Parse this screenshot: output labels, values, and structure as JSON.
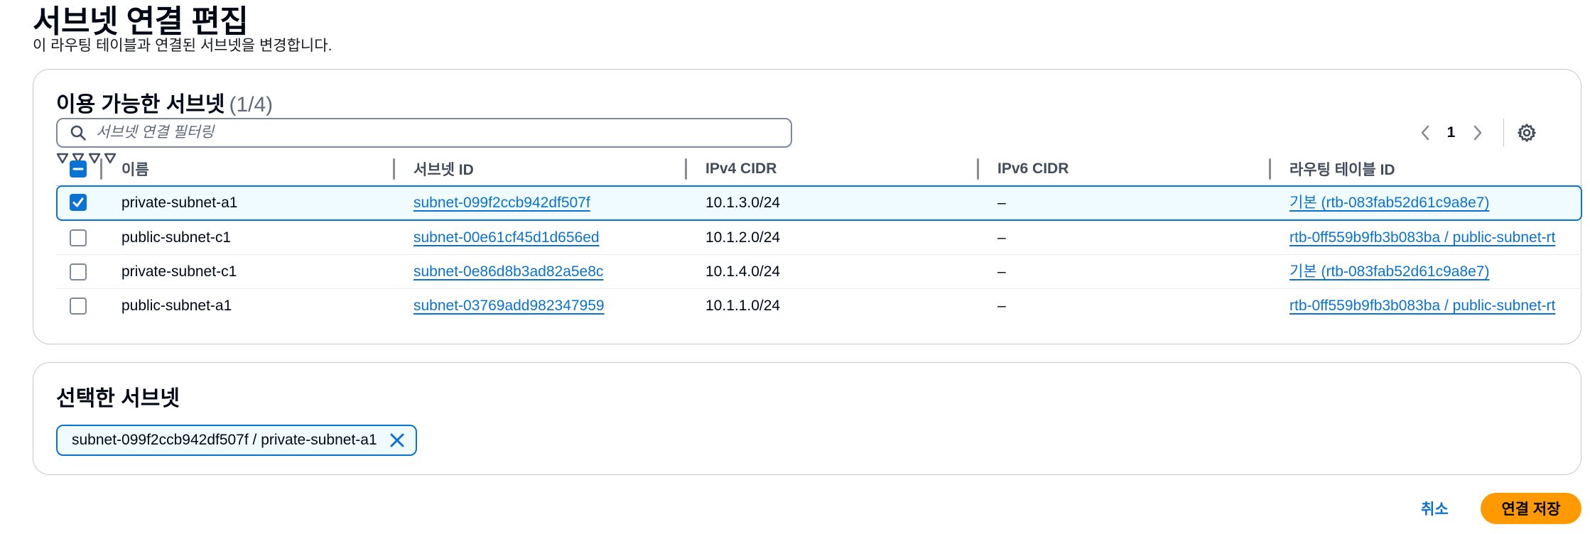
{
  "page": {
    "title": "서브넷 연결 편집",
    "description": "이 라우팅 테이블과 연결된 서브넷을 변경합니다."
  },
  "available": {
    "title": "이용 가능한 서브넷",
    "count": "(1/4)",
    "filter_placeholder": "서브넷 연결 필터링",
    "current_page": "1",
    "columns": [
      "이름",
      "서브넷 ID",
      "IPv4 CIDR",
      "IPv6 CIDR",
      "라우팅 테이블 ID"
    ],
    "rows": [
      {
        "name": "private-subnet-a1",
        "subnet_id": "subnet-099f2ccb942df507f",
        "ipv4": "10.1.3.0/24",
        "ipv6": "–",
        "route_table": "기본 (rtb-083fab52d61c9a8e7)",
        "checked": true
      },
      {
        "name": "public-subnet-c1",
        "subnet_id": "subnet-00e61cf45d1d656ed",
        "ipv4": "10.1.2.0/24",
        "ipv6": "–",
        "route_table": "rtb-0ff559b9fb3b083ba / public-subnet-rt",
        "checked": false
      },
      {
        "name": "private-subnet-c1",
        "subnet_id": "subnet-0e86d8b3ad82a5e8c",
        "ipv4": "10.1.4.0/24",
        "ipv6": "–",
        "route_table": "기본 (rtb-083fab52d61c9a8e7)",
        "checked": false
      },
      {
        "name": "public-subnet-a1",
        "subnet_id": "subnet-03769add982347959",
        "ipv4": "10.1.1.0/24",
        "ipv6": "–",
        "route_table": "rtb-0ff559b9fb3b083ba / public-subnet-rt",
        "checked": false
      }
    ]
  },
  "selected": {
    "title": "선택한 서브넷",
    "token": "subnet-099f2ccb942df507f / private-subnet-a1"
  },
  "footer": {
    "cancel_label": "취소",
    "save_label": "연결 저장"
  },
  "colors": {
    "link": "#0972d3",
    "primary_button": "#ff9900",
    "selected_row_bg": "#f0fbff",
    "border": "#c6c6cd"
  },
  "icons": [
    "search-icon",
    "chevron-left-icon",
    "chevron-right-icon",
    "settings-gear-icon",
    "sort-icon",
    "close-icon",
    "checkbox-checked-icon",
    "checkbox-indeterminate-icon"
  ]
}
